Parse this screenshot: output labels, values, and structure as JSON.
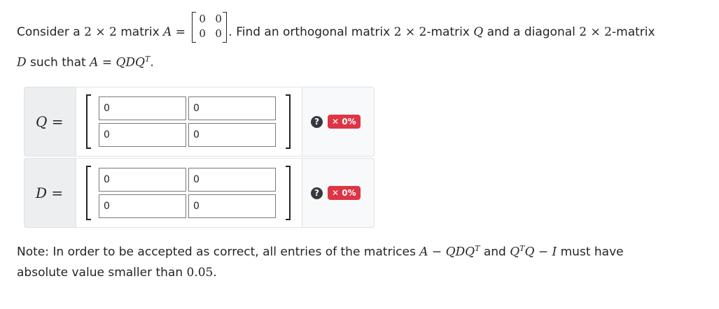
{
  "question": {
    "line1_a": "Consider a ",
    "dim_2": "2",
    "times": "×",
    "line1_b": " matrix ",
    "A": "A",
    "eq": "=",
    "matrix_A": [
      "0",
      "0",
      "0",
      "0"
    ],
    "line1_c": ". Find an orthogonal matrix ",
    "line1_d": "-matrix ",
    "Q": "Q",
    "line1_e": " and a diagonal ",
    "line1_f": "-matrix",
    "D": "D",
    "line2_a": " such that ",
    "line2_b": "QDQ",
    "T": "T",
    "period": "."
  },
  "rows": [
    {
      "label": "Q",
      "eq": "=",
      "values": [
        "0",
        "0",
        "0",
        "0"
      ],
      "help": "?",
      "badge": "✕ 0%"
    },
    {
      "label": "D",
      "eq": "=",
      "values": [
        "0",
        "0",
        "0",
        "0"
      ],
      "help": "?",
      "badge": "✕ 0%"
    }
  ],
  "note": {
    "a": "Note: In order to be accepted as correct, all entries of the matrices ",
    "expr1": "A − QDQ",
    "T": "T",
    "b": " and ",
    "expr2_q": "Q",
    "expr2_rest": "Q − I",
    "c": " must have",
    "d": "absolute value smaller than ",
    "threshold": "0.05",
    "period": "."
  },
  "colors": {
    "badge_bg": "#dc3545",
    "help_bg": "#343a40",
    "label_bg": "#eceeef"
  }
}
